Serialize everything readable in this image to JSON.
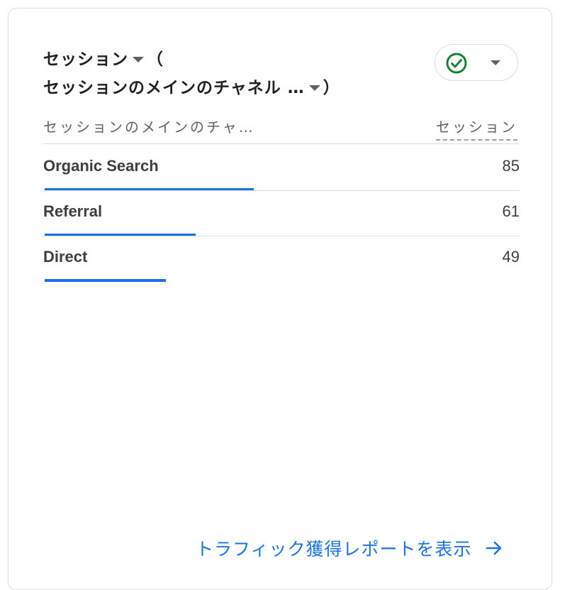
{
  "card": {
    "title_line1": "セッション",
    "title_paren_open": "（",
    "title_line2": "セッションのメインのチャネル …",
    "title_paren_close": "）",
    "status_icon": "check-circle-icon",
    "status_color": "#188038",
    "accent_color": "#1a73e8"
  },
  "table": {
    "dimension_header": "セッションのメインのチャ…",
    "metric_header": "セッション",
    "rows": [
      {
        "label": "Organic Search",
        "value": "85",
        "share": 0.44
      },
      {
        "label": "Referral",
        "value": "61",
        "share": 0.318
      },
      {
        "label": "Direct",
        "value": "49",
        "share": 0.255
      }
    ]
  },
  "footer": {
    "link_label": "トラフィック獲得レポートを表示",
    "link_icon": "arrow-right-icon"
  }
}
